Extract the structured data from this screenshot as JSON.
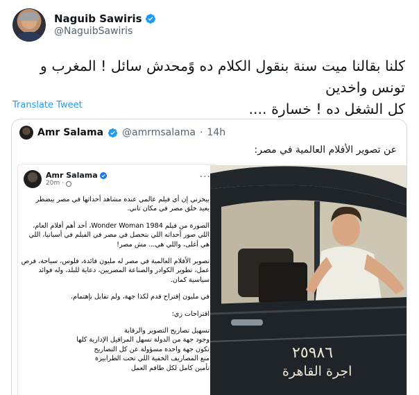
{
  "tweet": {
    "author_name": "Naguib Sawiris",
    "author_handle": "@NaguibSawiris",
    "text_lines": [
      "كلنا بقالنا ميت سنة بنقول الكلام ده وًمحدش سائل ! المغرب و تونس واخدين",
      "كل الشغل ده ! خسارة ...."
    ],
    "translate_label": "Translate Tweet"
  },
  "quoted": {
    "author_name": "Amr Salama",
    "author_handle": "@amrmsalama",
    "separator": "·",
    "time": "14h",
    "text": "عن تصوير الأفلام العالمية في مصر:"
  },
  "fb_post": {
    "author_name": "Amr Salama",
    "time": "20m",
    "dot": "·",
    "more": "···",
    "paragraphs": [
      [
        "بيحزني إن أي فيلم عالمي عنده مشاهد أحداثها في مصر بيضطر",
        "يعيد خلق مصر في مكان تاني."
      ],
      [
        "الصورة من فيلم Wonder Woman 1984، أحد أهم أفلام العام،",
        "اللي صور أحداثه اللي بتحصل في مصر في الفيلم في أسبانيا، اللي",
        "هي أغلى، واللي هي... مش مصر!"
      ],
      [
        "تصوير الأفلام العالمية في مصر له مليون فائدة، فلوس، سياحة، فرص",
        "عمل، تطوير الكوادر والصناعة المصريين، دعاية للبلد، وله فوائد",
        "سياسية كمان."
      ],
      [
        "في مليون إقتراح قدم لكذا جهة، ولم تقابل بإهتمام."
      ],
      [
        "اقتراحات زي:"
      ],
      [
        "تسهيل تصاريح التصوير والرقابة",
        "وجود جهة من الدولة تسهل المراقيل الإدارية كلها",
        "تكون جهة واحدة مسؤولة عن كل التصاريح",
        "منع المصاريف الخفية اللي تحت الطرابيزة",
        "تأمين كامل لكل طاقم العمل"
      ]
    ]
  },
  "photo": {
    "plate_number": "٢٥٩٨٦",
    "plate_city": "اجرة القاهرة"
  },
  "colors": {
    "accent": "#1d9bf0",
    "verified": "#1d9bf0",
    "fb_verified": "#1877f2",
    "border": "#cfd9de",
    "car_body": "#1f2428"
  },
  "icons": {
    "verified": "verified-badge-icon",
    "globe": "globe-icon",
    "more": "more-options-icon"
  }
}
